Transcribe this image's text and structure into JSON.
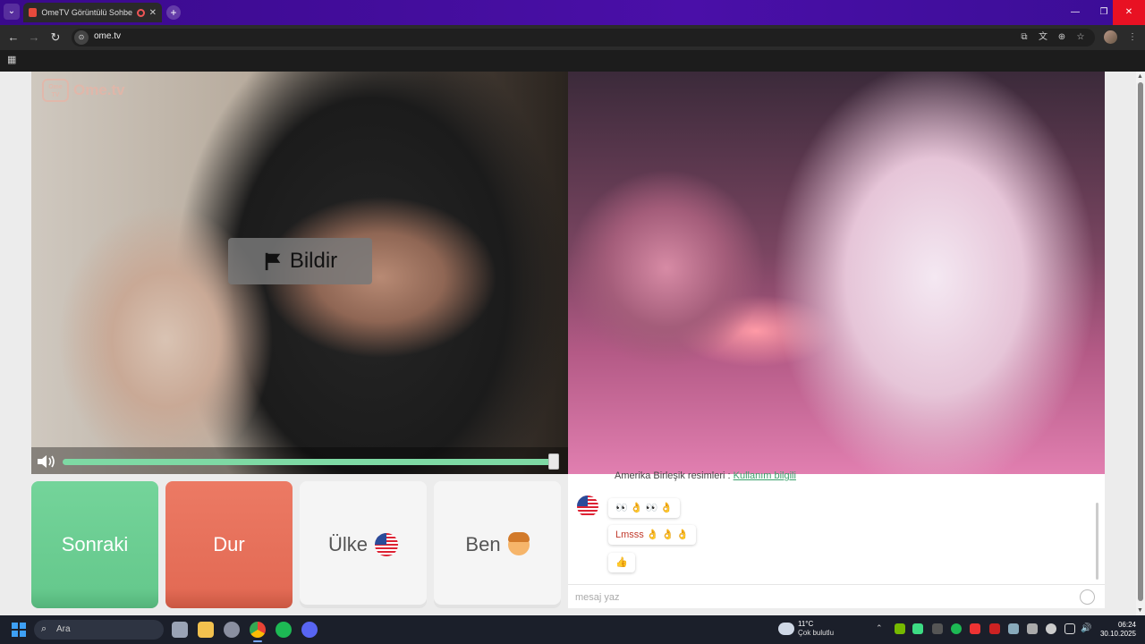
{
  "browser": {
    "tab_title": "OmeTV Görüntülü Sohbet -",
    "tab_close": "✕",
    "new_tab": "+",
    "url": "ome.tv",
    "window_controls": {
      "minimize": "—",
      "restore": "❐",
      "close": "✕"
    }
  },
  "video": {
    "logo_box": "Ome TV",
    "logo_text": "Ome.tv",
    "report_label": "Bildir"
  },
  "controls": {
    "next_label": "Sonraki",
    "stop_label": "Dur",
    "country_label": "Ülke",
    "me_label": "Ben",
    "volume_level": 1.0
  },
  "chat": {
    "system_prefix": "Amerika Birleşik resimleri :",
    "system_link": "Kullanım bilgili",
    "messages": [
      {
        "text": "👀 👌 👀 👌",
        "color": "#333333"
      },
      {
        "text": "Lmsss 👌 👌 👌",
        "color": "#c0392b"
      },
      {
        "text": "👍",
        "color": "#333333"
      }
    ],
    "input_placeholder": "mesaj yaz"
  },
  "taskbar": {
    "search_placeholder": "Ara",
    "weather_temp": "11°C",
    "weather_desc": "Çok bulutlu",
    "time": "06:24",
    "date": "30.10.2025"
  },
  "colors": {
    "next_button": "#6bcb92",
    "stop_button": "#e86f59",
    "volume_bar": "#7ed9a4",
    "chat_link": "#3aa06b",
    "title_bar": "#4a0fa8"
  }
}
